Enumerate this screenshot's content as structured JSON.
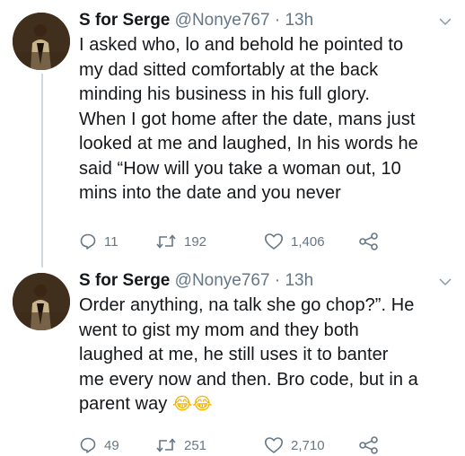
{
  "tweets": [
    {
      "author_name": "S for Serge",
      "handle": "@Nonye767",
      "separator": "·",
      "time": "13h",
      "text": "I asked who, lo and behold he pointed to\nmy dad sitted comfortably at the back\nminding his business in his full glory.\nWhen I got home after the date, mans just\nlooked at me and laughed, In his words he\nsaid “How will you take a woman out, 10\nmins into the date and you never",
      "replies": "11",
      "retweets": "192",
      "likes": "1,406"
    },
    {
      "author_name": "S for Serge",
      "handle": "@Nonye767",
      "separator": "·",
      "time": "13h",
      "text": "Order anything, na talk she go chop?”. He\nwent to gist my mom and they both\nlaughed at me, he still uses it to banter\nme every now and then. Bro code, but in a\nparent way",
      "emoji": "😂😂",
      "replies": "49",
      "retweets": "251",
      "likes": "2,710"
    }
  ],
  "icons": {
    "reply": "reply-icon",
    "retweet": "retweet-icon",
    "like": "heart-icon",
    "share": "share-icon",
    "more": "chevron-down-icon"
  },
  "colors": {
    "text": "#14171a",
    "secondary": "#657786",
    "thread_line": "#cfd9de"
  }
}
